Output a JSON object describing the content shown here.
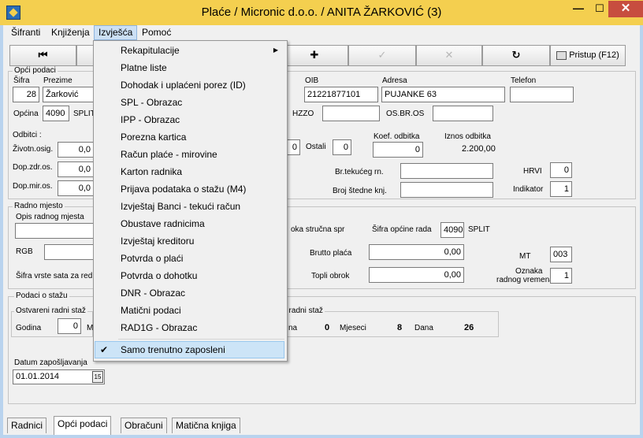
{
  "window": {
    "title": "Plaće / Micronic d.o.o.  / ANITA ŽARKOVIĆ (3)",
    "min": "—",
    "max": "☐",
    "close": "✕"
  },
  "menubar": [
    "Šifranti",
    "Knjiženja",
    "Izvješća",
    "Pomoć"
  ],
  "toolbar": {
    "first": "⏮",
    "add": "✚",
    "confirm": "✓",
    "cancel": "✕",
    "refresh": "↻",
    "pristup": "Pristup (F12)"
  },
  "opci": {
    "group": "Opći podaci",
    "sifra_label": "Šifra",
    "sifra": "28",
    "prezime_label": "Prezime",
    "prezime": "Žarković",
    "oib_label": "OIB",
    "oib": "21221877101",
    "adresa_label": "Adresa",
    "adresa": "PUJANKE 63",
    "telefon_label": "Telefon",
    "telefon": "",
    "opcina_label": "Općina",
    "opcina": "4090",
    "opcina_name": "SPLIT",
    "hzzo_label": "HZZO",
    "osbr_label": "OS.BR.OS",
    "odbitci_label": "Odbitci :",
    "zivotn_label": "Životn.osig.",
    "zivotn": "0,0",
    "dopzdr_label": "Dop.zdr.os.",
    "dopzdr": "0,0",
    "dopmir_label": "Dop.mir.os.",
    "dopmir": "0,0",
    "odbitci_val": "0",
    "ostali_label": "Ostali",
    "ostali": "0",
    "koef_label": "Koef. odbitka",
    "koef": "0",
    "iznos_label": "Iznos odbitka",
    "iznos": "2.200,00",
    "brtek_label": "Br.tekućeg rn.",
    "brstednje_label": "Broj štedne knj.",
    "hrvi_label": "HRVI",
    "hrvi": "0",
    "indikator_label": "Indikator",
    "indikator": "1"
  },
  "radno": {
    "group": "Radno mjesto",
    "opis_label": "Opis radnog mjesta",
    "rgb_label": "RGB",
    "sifra_vrste_label": "Šifra vrste sata za red",
    "strucna_label": "oka stručna spr",
    "sifra_opcine_label": "Šifra općine rada",
    "sifra_opcine": "4090",
    "sifra_opcine_name": "SPLIT",
    "brutto_label": "Brutto plaća",
    "brutto": "0,00",
    "topli_label": "Topli obrok",
    "topli": "0,00",
    "mt_label": "MT",
    "mt": "003",
    "oznaka_label1": "Oznaka",
    "oznaka_label2": "radnog vremena",
    "oznaka": "1"
  },
  "staz": {
    "group": "Podaci o stažu",
    "ostvareni_label": "Ostvareni radni staž",
    "godina_label": "Godina",
    "godina": "0",
    "m_label": "M",
    "radni_staz_label": "ni radni staž",
    "na_label": "na",
    "na_val": "0",
    "mjeseci_label": "Mjeseci",
    "mjeseci": "8",
    "dana_label": "Dana",
    "dana": "26",
    "datum_label": "Datum zapošljavanja",
    "datum": "01.01.2014",
    "cal_icon": "15"
  },
  "tabs": [
    "Radnici",
    "Opći podaci",
    "Obračuni",
    "Matična knjiga"
  ],
  "dropdown": {
    "items": [
      "Rekapitulacije",
      "Platne liste",
      "Dohodak i uplaćeni porez (ID)",
      "SPL - Obrazac",
      "IPP - Obrazac",
      "Porezna kartica",
      "Račun plaće - mirovine",
      "Karton radnika",
      "Prijava podataka o stažu (M4)",
      "Izvještaj Banci - tekući račun",
      "Obustave radnicima",
      "Izvještaj kreditoru",
      "Potvrda o plaći",
      "Potvrda o dohotku",
      "DNR - Obrazac",
      "Matični podaci",
      "RAD1G - Obrazac"
    ],
    "submenu_arrow": "▶",
    "check_mark": "✔",
    "checked_item": "Samo trenutno zaposleni"
  }
}
